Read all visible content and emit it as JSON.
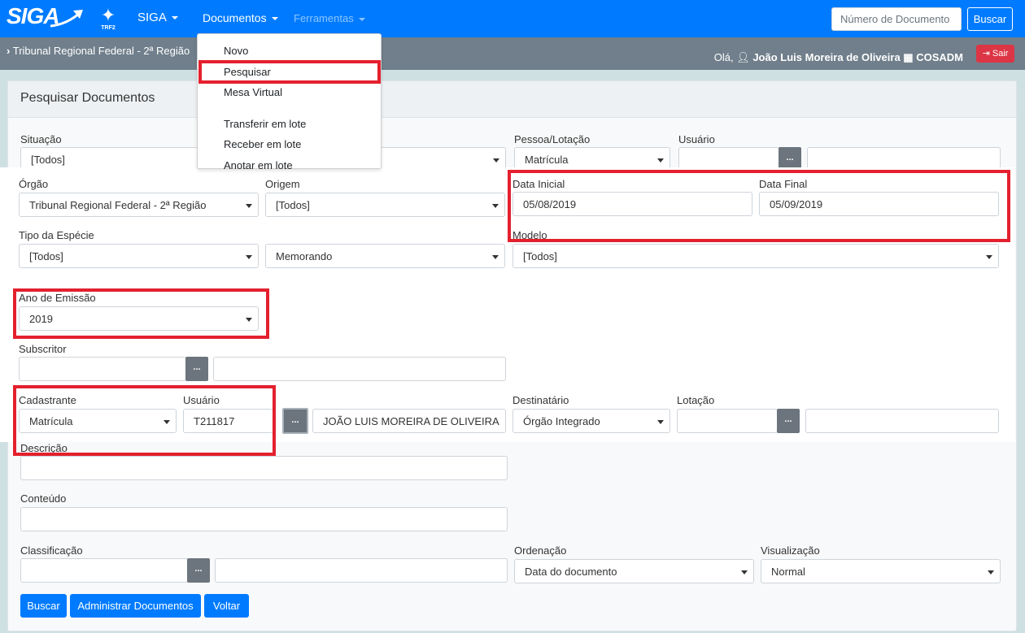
{
  "nav": {
    "logo": "SIGA",
    "trf_text": "TRF2",
    "siga_menu": "SIGA",
    "documentos_menu": "Documentos",
    "ferramentas_menu": "Ferramentas",
    "docnum_placeholder": "Número de Documento",
    "buscar_label": "Buscar"
  },
  "subbar": {
    "breadcrumb": "Tribunal Regional Federal - 2ª Região",
    "greeting": "Olá,",
    "user_name": "João Luis Moreira de Oliveira",
    "lotacao": "COSADM",
    "sair_label": "Sair"
  },
  "dropdown": {
    "items": [
      "Novo",
      "Pesquisar",
      "Mesa Virtual",
      "Transferir em lote",
      "Receber em lote",
      "Anotar em lote"
    ]
  },
  "page": {
    "title": "Pesquisar Documentos"
  },
  "form": {
    "situacao_label": "Situação",
    "situacao_value": "[Todos]",
    "pessoa_lotacao_label": "Pessoa/Lotação",
    "pessoa_lotacao_value": "Matrícula",
    "usuario_top_label": "Usuário",
    "orgao_label": "Órgão",
    "orgao_value": "Tribunal Regional Federal - 2ª Região",
    "origem_label": "Origem",
    "origem_value": "[Todos]",
    "data_inicial_label": "Data Inicial",
    "data_inicial_value": "05/08/2019",
    "data_final_label": "Data Final",
    "data_final_value": "05/09/2019",
    "tipo_especie_label": "Tipo da Espécie",
    "tipo_especie_value": "[Todos]",
    "especie_value": "Memorando",
    "modelo_label": "Modelo",
    "modelo_value": "[Todos]",
    "ano_emissao_label": "Ano de Emissão",
    "ano_emissao_value": "2019",
    "subscritor_label": "Subscritor",
    "cadastrante_label": "Cadastrante",
    "cadastrante_value": "Matrícula",
    "usuario_label": "Usuário",
    "usuario_value": "T211817",
    "usuario_name": "JOÃO LUIS MOREIRA DE OLIVEIRA",
    "destinatario_label": "Destinatário",
    "destinatario_value": "Órgão Integrado",
    "lotacao_label": "Lotação",
    "descricao_label": "Descrição",
    "conteudo_label": "Conteúdo",
    "classificacao_label": "Classificação",
    "ordenacao_label": "Ordenação",
    "ordenacao_value": "Data do documento",
    "visualizacao_label": "Visualização",
    "visualizacao_value": "Normal",
    "dots_label": "..."
  },
  "buttons": {
    "buscar": "Buscar",
    "administrar": "Administrar Documentos",
    "voltar": "Voltar"
  },
  "colors": {
    "primary": "#007bff",
    "subbar": "#707f8b",
    "danger": "#dc3545",
    "highlight": "#e4202e"
  }
}
